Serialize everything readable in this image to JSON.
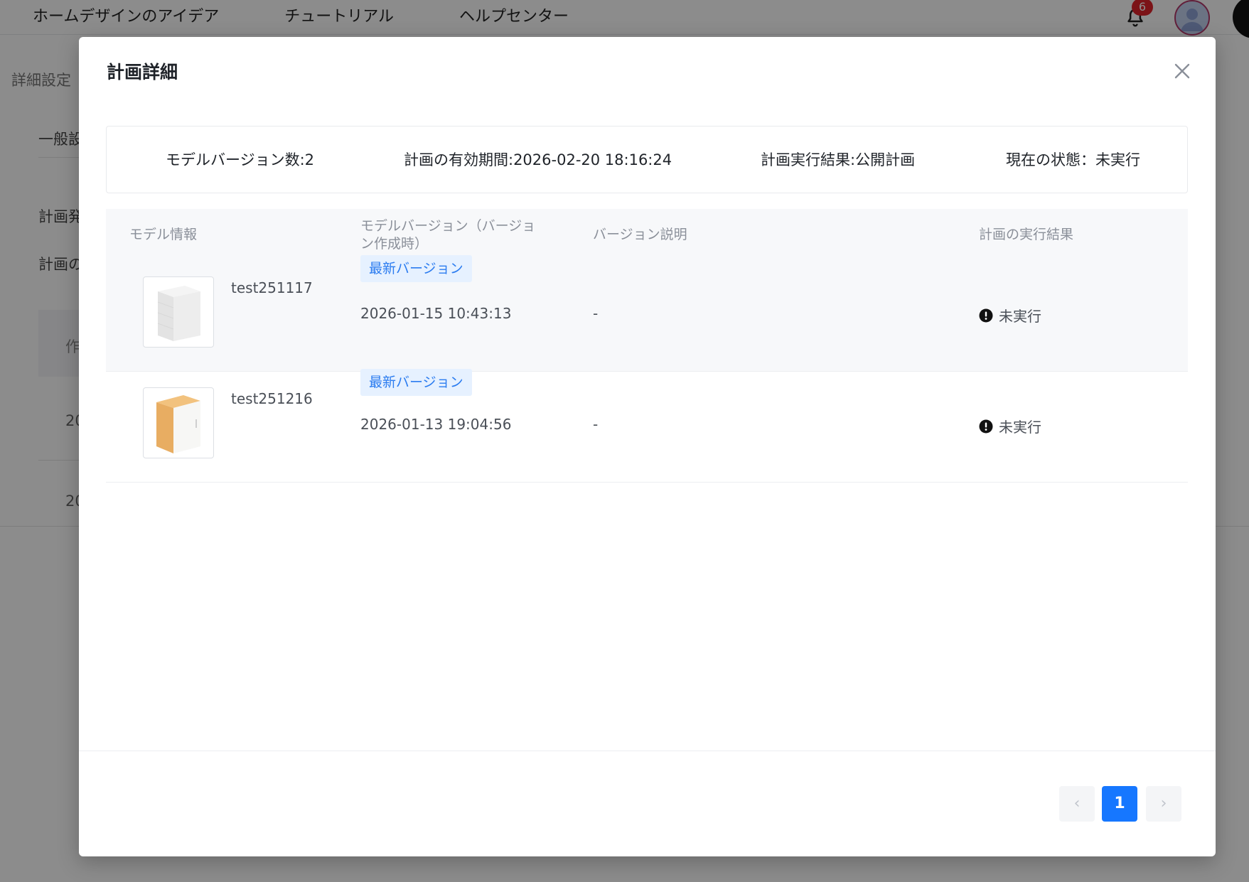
{
  "topnav": [
    "ホームデザインのアイデア",
    "チュートリアル",
    "ヘルプセンター"
  ],
  "notifications": {
    "count": "6"
  },
  "background": {
    "breadcrumb": "詳細設定",
    "tab": "一般設",
    "row1": "計画発",
    "row2": "計画の",
    "col": "作",
    "cell1": "20",
    "cell2": "20"
  },
  "modal": {
    "title": "計画詳細",
    "summary": {
      "model_versions": "モデルバージョン数:2",
      "valid_period": "計画の有効期間:2026-02-20 18:16:24",
      "exec_result": "計画実行結果:公開計画",
      "current_status": "現在の状態：未実行"
    },
    "table": {
      "headers": {
        "model_info": "モデル情報",
        "model_version_line1": "モデルバージョン（バージョ",
        "model_version_line2": "ン作成時）",
        "version_desc": "バージョン説明",
        "exec_result": "計画の実行結果"
      },
      "rows": [
        {
          "name": "test251117",
          "tag": "最新バージョン",
          "date": "2026-01-15 10:43:13",
          "desc": "-",
          "result": "未実行"
        },
        {
          "name": "test251216",
          "tag": "最新バージョン",
          "date": "2026-01-13 19:04:56",
          "desc": "-",
          "result": "未実行"
        }
      ]
    },
    "pagination": {
      "prev": "‹",
      "current": "1",
      "next": "›"
    }
  }
}
